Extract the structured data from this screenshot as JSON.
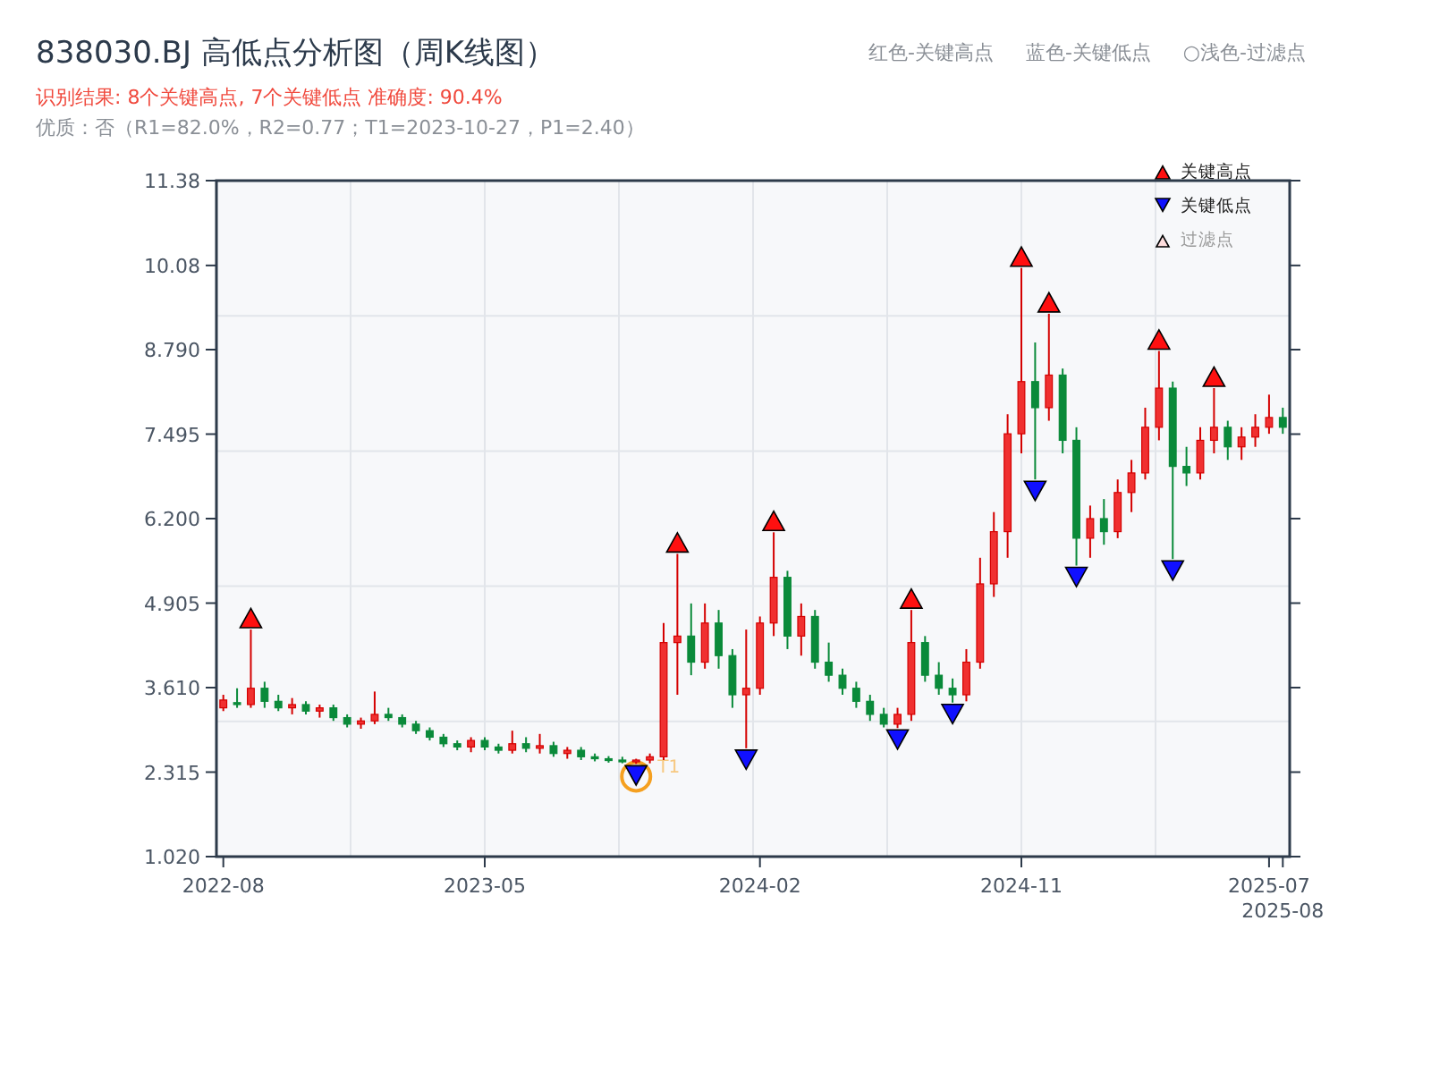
{
  "title": "838030.BJ 高低点分析图（周K线图）",
  "header_legend": [
    "红色-关键高点",
    "蓝色-关键低点",
    "○浅色-过滤点"
  ],
  "result_line": "识别结果: 8个关键高点, 7个关键低点  准确度: 90.4%",
  "quality_line": "优质：否（R1=82.0%，R2=0.77；T1=2023-10-27，P1=2.40）",
  "legend": [
    {
      "kind": "high",
      "label": "关键高点"
    },
    {
      "kind": "low",
      "label": "关键低点"
    },
    {
      "kind": "filtered",
      "label": "过滤点"
    }
  ],
  "key_points": {
    "high": [
      false,
      false,
      true,
      false,
      false,
      false,
      false,
      false,
      false,
      false,
      false,
      false,
      false,
      false,
      false,
      false,
      false,
      false,
      false,
      false,
      false,
      false,
      false,
      false,
      false,
      false,
      false,
      false,
      false,
      false,
      false,
      false,
      false,
      true,
      false,
      false,
      false,
      false,
      false,
      false,
      true,
      false,
      false,
      false,
      false,
      false,
      false,
      false,
      false,
      false,
      true,
      false,
      false,
      false,
      false,
      false,
      false,
      false,
      true,
      false,
      true,
      false,
      false,
      false,
      false,
      false,
      false,
      false,
      true,
      false,
      false,
      false,
      true,
      false,
      false,
      false,
      false,
      false
    ],
    "low": [
      false,
      false,
      false,
      false,
      false,
      false,
      false,
      false,
      false,
      false,
      false,
      false,
      false,
      false,
      false,
      false,
      false,
      false,
      false,
      false,
      false,
      false,
      false,
      false,
      false,
      false,
      false,
      false,
      false,
      false,
      true,
      false,
      false,
      false,
      false,
      false,
      false,
      false,
      true,
      false,
      false,
      false,
      false,
      false,
      false,
      false,
      false,
      false,
      false,
      true,
      false,
      false,
      false,
      true,
      false,
      false,
      false,
      false,
      false,
      true,
      false,
      false,
      true,
      false,
      false,
      false,
      false,
      false,
      false,
      true,
      false,
      false,
      false,
      false,
      false,
      false,
      false,
      false
    ]
  },
  "t1_mark": {
    "text": "T1"
  },
  "chart_data": {
    "type": "candlestick",
    "ylim": [
      1.02,
      11.38
    ],
    "categories": [
      "2022-08",
      null,
      null,
      null,
      null,
      null,
      null,
      null,
      null,
      null,
      null,
      null,
      null,
      null,
      null,
      null,
      null,
      null,
      null,
      "2023-05",
      null,
      null,
      null,
      null,
      null,
      null,
      null,
      null,
      null,
      null,
      null,
      null,
      null,
      null,
      null,
      null,
      null,
      null,
      null,
      "2024-02",
      null,
      null,
      null,
      null,
      null,
      null,
      null,
      null,
      null,
      null,
      null,
      null,
      null,
      null,
      null,
      null,
      null,
      null,
      "2024-11",
      null,
      null,
      null,
      null,
      null,
      null,
      null,
      null,
      null,
      null,
      null,
      null,
      null,
      null,
      null,
      null,
      null,
      "2025-07",
      "2025-08"
    ],
    "ohlc": [
      [
        3.3,
        3.5,
        3.25,
        3.42
      ],
      [
        3.38,
        3.6,
        3.3,
        3.35
      ],
      [
        3.35,
        4.5,
        3.3,
        3.6
      ],
      [
        3.6,
        3.7,
        3.3,
        3.4
      ],
      [
        3.4,
        3.5,
        3.25,
        3.3
      ],
      [
        3.3,
        3.45,
        3.2,
        3.35
      ],
      [
        3.35,
        3.4,
        3.2,
        3.25
      ],
      [
        3.25,
        3.35,
        3.15,
        3.3
      ],
      [
        3.3,
        3.35,
        3.1,
        3.15
      ],
      [
        3.15,
        3.2,
        3.0,
        3.05
      ],
      [
        3.05,
        3.15,
        2.98,
        3.1
      ],
      [
        3.1,
        3.55,
        3.05,
        3.2
      ],
      [
        3.2,
        3.3,
        3.1,
        3.15
      ],
      [
        3.15,
        3.2,
        3.0,
        3.05
      ],
      [
        3.05,
        3.1,
        2.9,
        2.95
      ],
      [
        2.95,
        3.0,
        2.8,
        2.85
      ],
      [
        2.85,
        2.9,
        2.7,
        2.75
      ],
      [
        2.75,
        2.8,
        2.65,
        2.7
      ],
      [
        2.7,
        2.85,
        2.62,
        2.8
      ],
      [
        2.8,
        2.85,
        2.65,
        2.7
      ],
      [
        2.7,
        2.75,
        2.6,
        2.65
      ],
      [
        2.65,
        2.95,
        2.6,
        2.75
      ],
      [
        2.75,
        2.85,
        2.62,
        2.68
      ],
      [
        2.68,
        2.9,
        2.6,
        2.72
      ],
      [
        2.72,
        2.78,
        2.55,
        2.6
      ],
      [
        2.6,
        2.7,
        2.52,
        2.65
      ],
      [
        2.65,
        2.7,
        2.5,
        2.55
      ],
      [
        2.55,
        2.6,
        2.48,
        2.52
      ],
      [
        2.52,
        2.56,
        2.46,
        2.5
      ],
      [
        2.5,
        2.55,
        2.45,
        2.48
      ],
      [
        2.48,
        2.52,
        2.44,
        2.5
      ],
      [
        2.5,
        2.6,
        2.45,
        2.55
      ],
      [
        2.55,
        4.6,
        2.5,
        4.3
      ],
      [
        4.3,
        5.66,
        3.5,
        4.4
      ],
      [
        4.4,
        4.9,
        3.8,
        4.0
      ],
      [
        4.0,
        4.9,
        3.9,
        4.6
      ],
      [
        4.6,
        4.8,
        3.9,
        4.1
      ],
      [
        4.1,
        4.2,
        3.3,
        3.5
      ],
      [
        3.5,
        4.5,
        2.68,
        3.6
      ],
      [
        3.6,
        4.7,
        3.5,
        4.6
      ],
      [
        4.6,
        5.99,
        4.4,
        5.3
      ],
      [
        5.3,
        5.4,
        4.2,
        4.4
      ],
      [
        4.4,
        4.9,
        4.1,
        4.7
      ],
      [
        4.7,
        4.8,
        3.9,
        4.0
      ],
      [
        4.0,
        4.3,
        3.7,
        3.8
      ],
      [
        3.8,
        3.9,
        3.5,
        3.6
      ],
      [
        3.6,
        3.7,
        3.3,
        3.4
      ],
      [
        3.4,
        3.5,
        3.1,
        3.2
      ],
      [
        3.2,
        3.3,
        3.0,
        3.05
      ],
      [
        3.05,
        3.3,
        2.99,
        3.2
      ],
      [
        3.2,
        4.8,
        3.1,
        4.3
      ],
      [
        4.3,
        4.4,
        3.7,
        3.8
      ],
      [
        3.8,
        4.0,
        3.5,
        3.6
      ],
      [
        3.6,
        3.75,
        3.38,
        3.5
      ],
      [
        3.5,
        4.2,
        3.4,
        4.0
      ],
      [
        4.0,
        5.6,
        3.9,
        5.2
      ],
      [
        5.2,
        6.3,
        5.0,
        6.0
      ],
      [
        6.0,
        7.8,
        5.6,
        7.5
      ],
      [
        7.5,
        10.04,
        7.2,
        8.3
      ],
      [
        8.3,
        8.9,
        6.8,
        7.9
      ],
      [
        7.9,
        9.34,
        7.7,
        8.4
      ],
      [
        8.4,
        8.5,
        7.2,
        7.4
      ],
      [
        7.4,
        7.6,
        5.48,
        5.9
      ],
      [
        5.9,
        6.4,
        5.6,
        6.2
      ],
      [
        6.2,
        6.5,
        5.8,
        6.0
      ],
      [
        6.0,
        6.8,
        5.9,
        6.6
      ],
      [
        6.6,
        7.1,
        6.3,
        6.9
      ],
      [
        6.9,
        7.9,
        6.8,
        7.6
      ],
      [
        7.6,
        8.77,
        7.4,
        8.2
      ],
      [
        8.2,
        8.3,
        5.58,
        7.0
      ],
      [
        7.0,
        7.3,
        6.7,
        6.9
      ],
      [
        6.9,
        7.6,
        6.8,
        7.4
      ],
      [
        7.4,
        8.2,
        7.2,
        7.6
      ],
      [
        7.6,
        7.7,
        7.1,
        7.3
      ],
      [
        7.3,
        7.6,
        7.1,
        7.45
      ],
      [
        7.45,
        7.8,
        7.3,
        7.6
      ],
      [
        7.6,
        8.1,
        7.5,
        7.75
      ],
      [
        7.75,
        7.9,
        7.5,
        7.6
      ]
    ],
    "yticks": [
      {
        "value": 1.02,
        "label": "1.020"
      },
      {
        "value": 2.315,
        "label": "2.315"
      },
      {
        "value": 3.61,
        "label": "3.610"
      },
      {
        "value": 4.905,
        "label": "4.905"
      },
      {
        "value": 6.2,
        "label": "6.200"
      },
      {
        "value": 7.495,
        "label": "7.495"
      },
      {
        "value": 8.79,
        "label": "8.790"
      },
      {
        "value": 10.08,
        "label": "10.08"
      },
      {
        "value": 11.38,
        "label": "11.38"
      }
    ]
  }
}
